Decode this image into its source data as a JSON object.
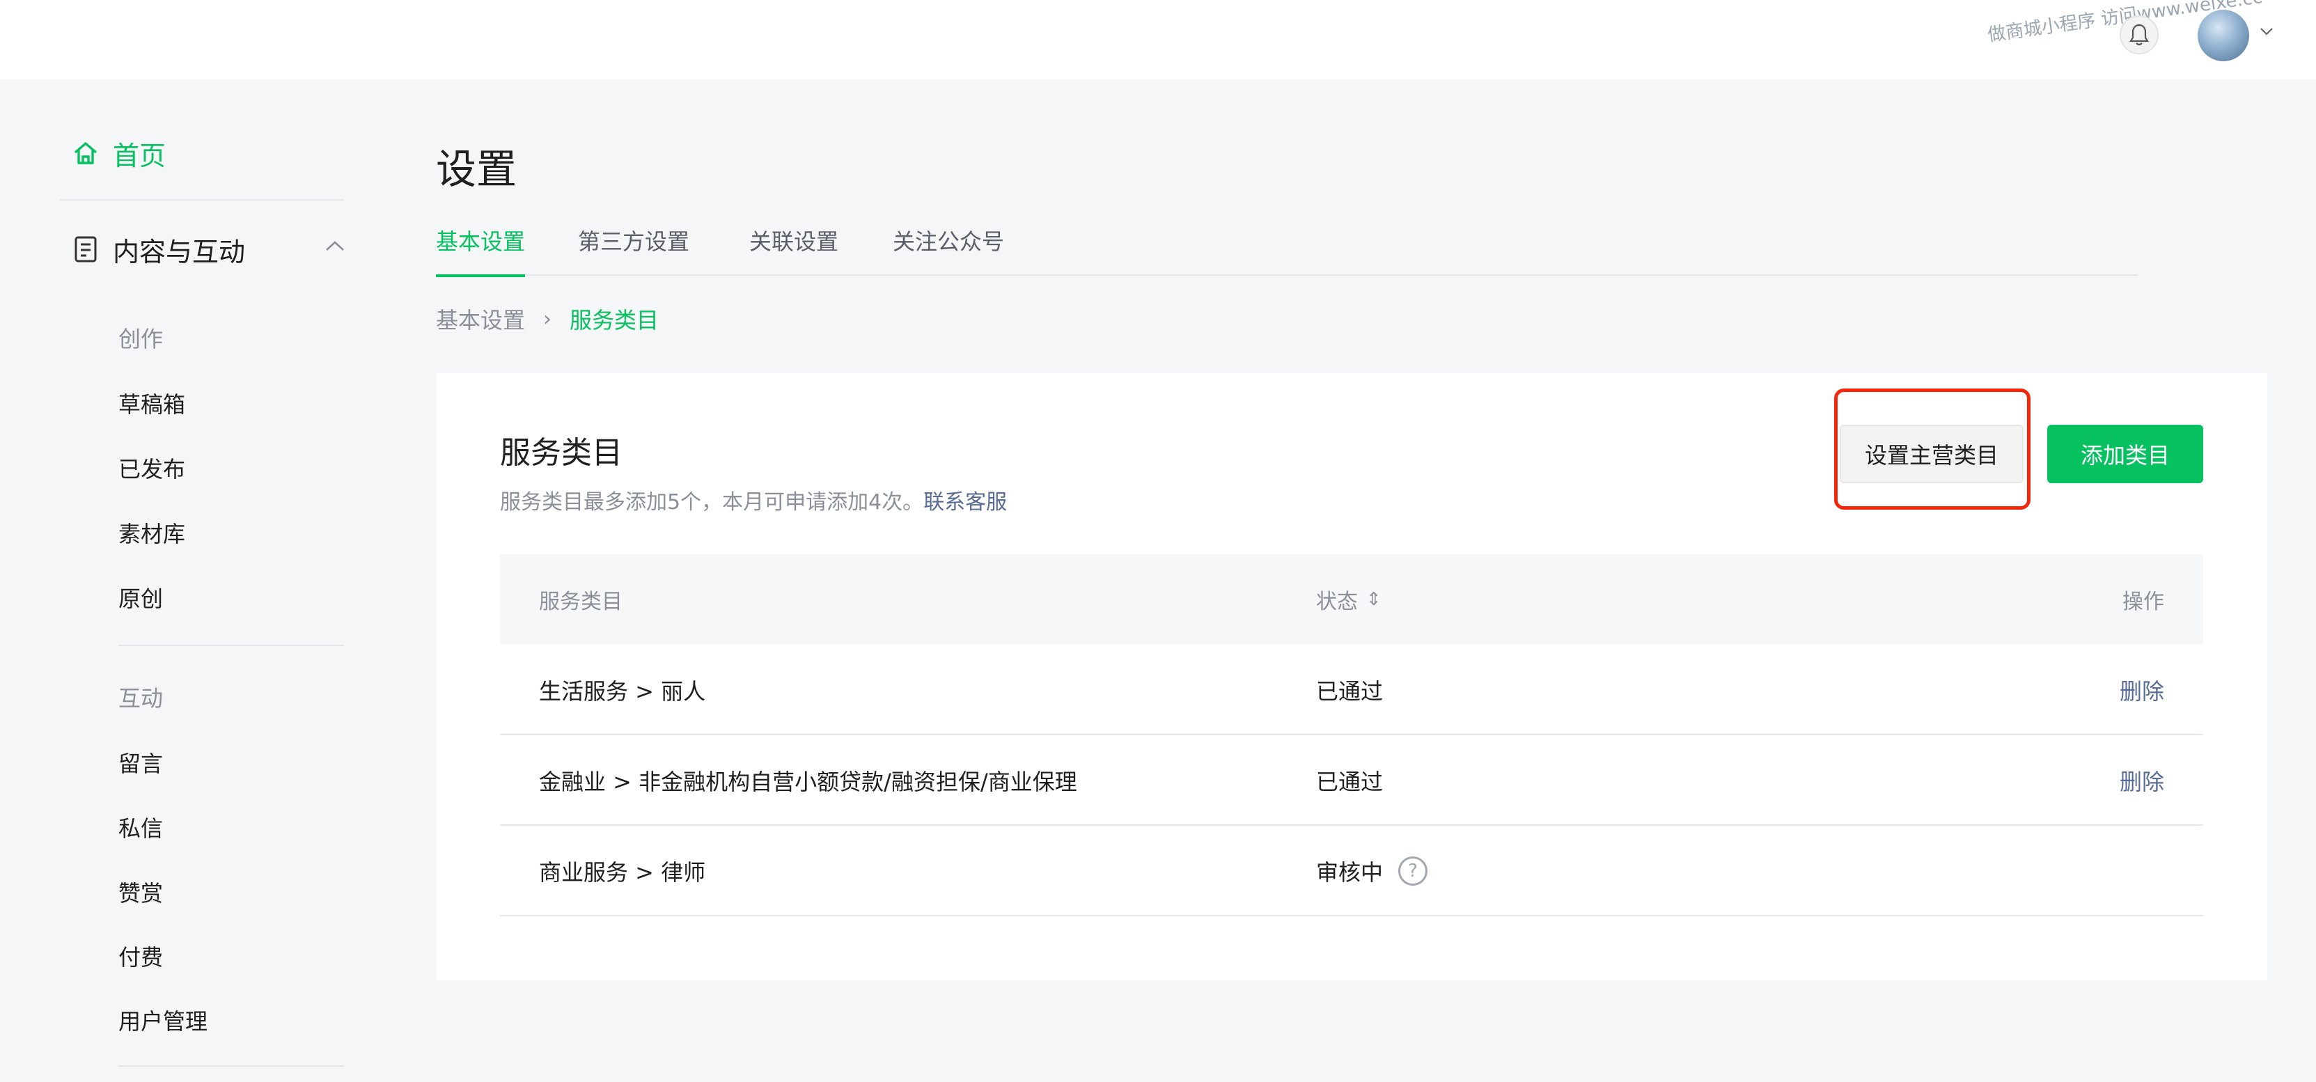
{
  "header": {
    "watermark": "做商城小程序 访问www.weixe.cc"
  },
  "sidebar": {
    "home_label": "首页",
    "group_label": "内容与互动",
    "section_create": "创作",
    "create_items": [
      "草稿箱",
      "已发布",
      "素材库",
      "原创"
    ],
    "section_interact": "互动",
    "interact_items": [
      "留言",
      "私信",
      "赞赏",
      "付费",
      "用户管理"
    ]
  },
  "page": {
    "title": "设置",
    "tabs": [
      "基本设置",
      "第三方设置",
      "关联设置",
      "关注公众号"
    ],
    "active_tab": "基本设置",
    "breadcrumb": {
      "parent": "基本设置",
      "separator": "›",
      "current": "服务类目"
    }
  },
  "card": {
    "title": "服务类目",
    "desc_text": "服务类目最多添加5个，本月可申请添加4次。",
    "desc_link": "联系客服",
    "btn_set_main": "设置主营类目",
    "btn_add": "添加类目"
  },
  "table": {
    "headers": [
      "服务类目",
      "状态",
      "操作"
    ],
    "sort_icon": "⇕",
    "rows": [
      {
        "category": "生活服务 > 丽人",
        "status": "已通过",
        "action": "删除"
      },
      {
        "category": "金融业 > 非金融机构自营小额贷款/融资担保/商业保理",
        "status": "已通过",
        "action": "删除"
      },
      {
        "category": "商业服务 > 律师",
        "status": "审核中",
        "action": ""
      }
    ],
    "help_glyph": "?"
  },
  "colors": {
    "accent": "#07c160",
    "link": "#576b95",
    "highlight": "#f4270d"
  }
}
